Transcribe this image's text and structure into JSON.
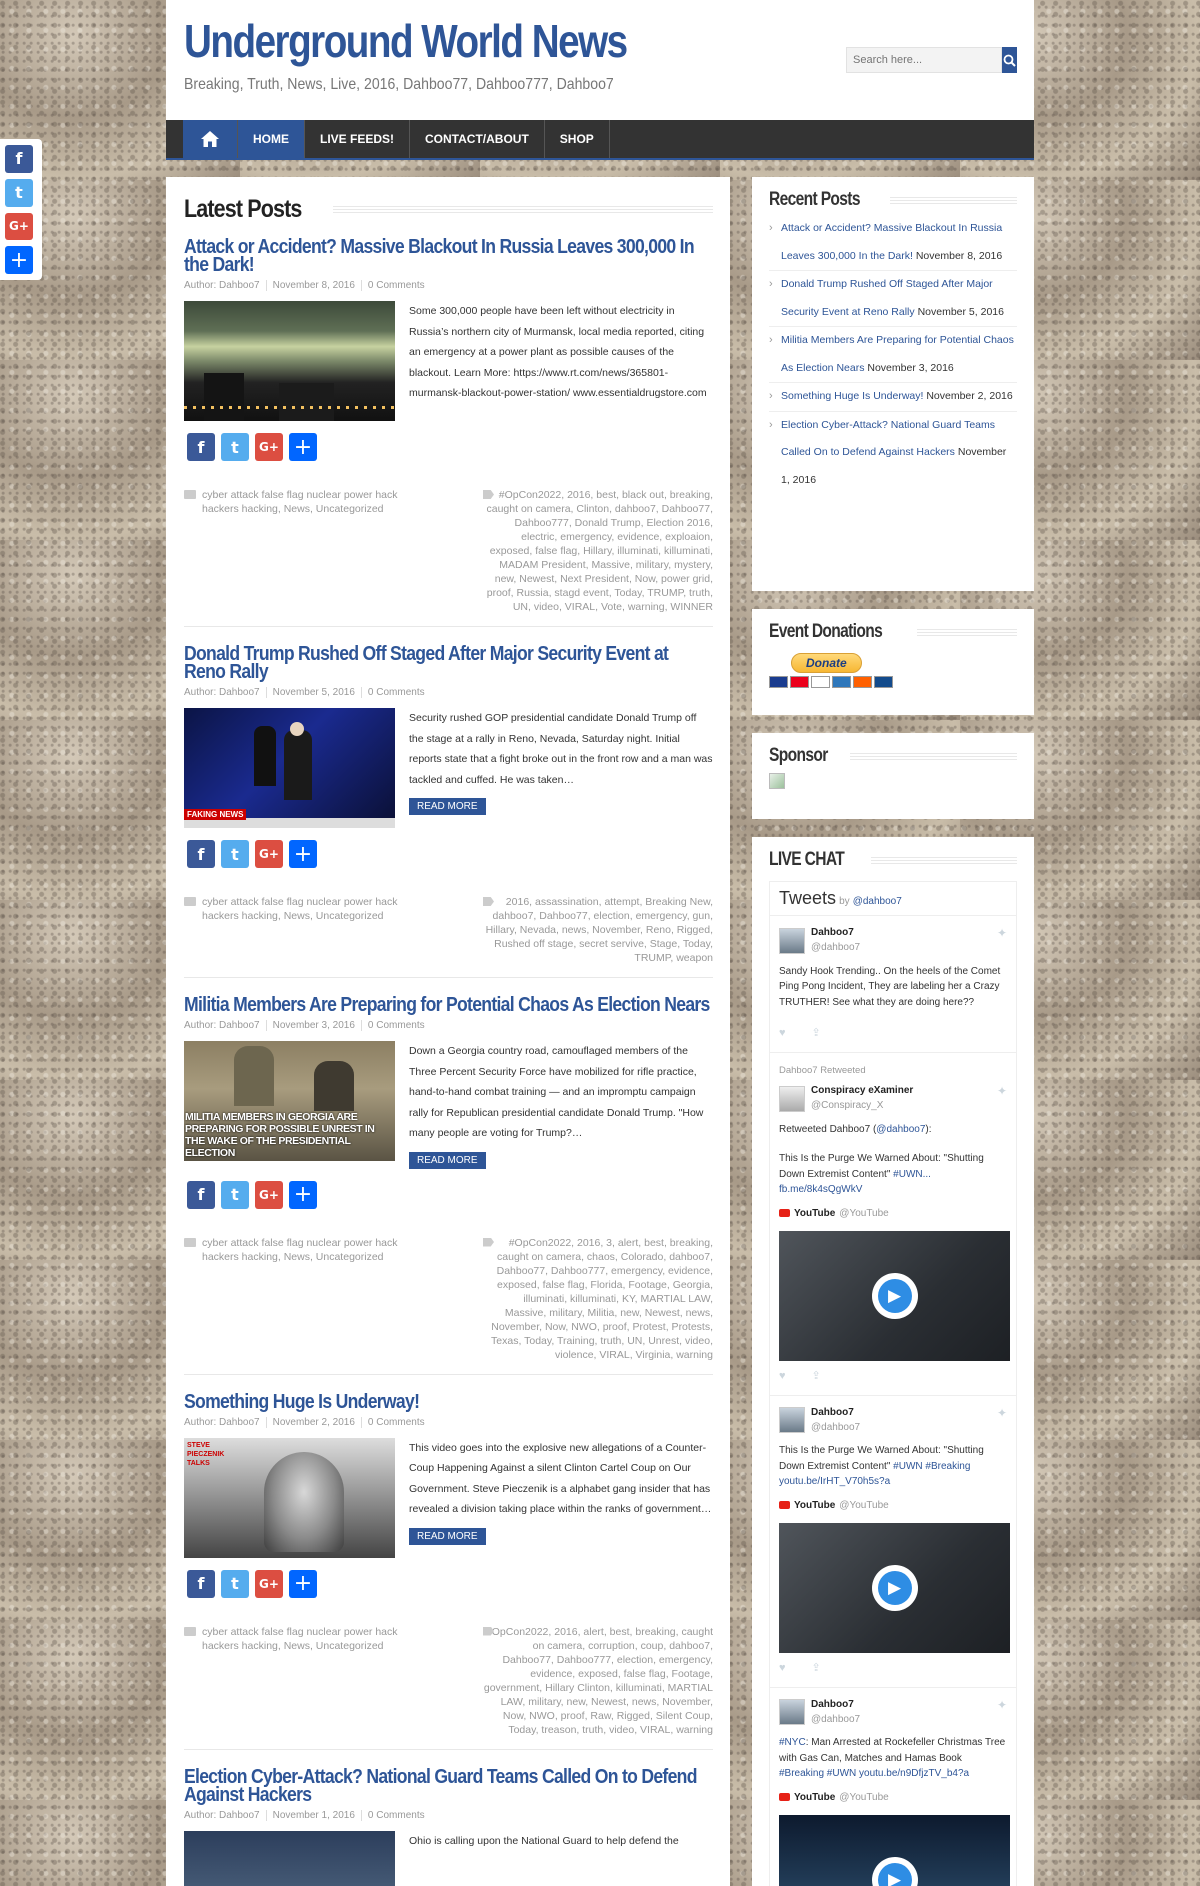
{
  "site": {
    "title": "Underground World News",
    "tagline": "Breaking, Truth, News, Live, 2016, Dahboo77, Dahboo777, Dahboo7"
  },
  "search": {
    "placeholder": "Search here..."
  },
  "nav": [
    "HOME",
    "LIVE FEEDS!",
    "CONTACT/ABOUT",
    "SHOP"
  ],
  "float_share": [
    "f",
    "t",
    "G+",
    "+"
  ],
  "main": {
    "section_title": "Latest Posts",
    "read_more": "READ MORE",
    "posts": [
      {
        "title": "Attack or Accident? Massive Blackout In Russia Leaves 300,000 In the Dark!",
        "author": "Author: Dahboo7",
        "date": "November 8, 2016",
        "comments": "0 Comments",
        "excerpt": "Some 300,000 people have been left without electricity in Russia’s northern city of Murmansk, local media reported, citing an emergency at a power plant as possible causes of the blackout.   Learn More: https://www.rt.com/news/365801-murmansk-blackout-power-station/ www.essentialdrugstore.com",
        "categories": "cyber attack false flag nuclear power hack hackers hacking, News, Uncategorized",
        "tags": "#OpCon2022, 2016, best, black out, breaking, caught on camera, Clinton, dahboo7, Dahboo77, Dahboo777, Donald Trump, Election 2016, electric, emergency, evidence, exploaion, exposed, false flag, Hillary, illuminati, killuminati, MADAM President, Massive, military, mystery, new, Newest, Next President, Now, power grid, proof, Russia, stagd event, Today, TRUMP, truth, UN, video, VIRAL, Vote, warning, WINNER"
      },
      {
        "title": "Donald Trump Rushed Off Staged After Major Security Event at Reno Rally",
        "author": "Author: Dahboo7",
        "date": "November 5, 2016",
        "comments": "0 Comments",
        "excerpt": "Security rushed GOP presidential candidate Donald Trump off the stage at a rally in Reno, Nevada, Saturday night. Initial reports state that a fight broke out in the front row and a man was tackled and cuffed. He was taken…",
        "thumb_caption": "FAKING NEWS",
        "categories": "cyber attack false flag nuclear power hack hackers hacking, News, Uncategorized",
        "tags": "2016, assassination, attempt, Breaking New, dahboo7, Dahboo77, election, emergency, gun, Hillary, Nevada, news, November, Reno, Rigged, Rushed off stage, secret servive, Stage, Today, TRUMP, weapon"
      },
      {
        "title": "Militia Members Are Preparing for Potential Chaos As Election Nears",
        "author": "Author: Dahboo7",
        "date": "November 3, 2016",
        "comments": "0 Comments",
        "excerpt": "Down a Georgia country road, camouflaged members of the Three Percent Security Force have mobilized for rifle practice, hand-to-hand combat training — and an impromptu campaign rally for Republican presidential candidate Donald Trump. \"How many people are voting for Trump?…",
        "thumb_caption": "MILITIA MEMBERS IN GEORGIA ARE PREPARING FOR POSSIBLE UNREST IN THE WAKE OF THE PRESIDENTIAL ELECTION",
        "categories": "cyber attack false flag nuclear power hack hackers hacking, News, Uncategorized",
        "tags": "#OpCon2022, 2016, 3, alert, best, breaking, caught on camera, chaos, Colorado, dahboo7, Dahboo77, Dahboo777, emergency, evidence, exposed, false flag, Florida, Footage, Georgia, illuminati, killuminati, KY, MARTIAL LAW, Massive, military, Militia, new, Newest, news, November, Now, NWO, proof, Protest, Protests, Texas, Today, Training, truth, UN, Unrest, video, violence, VIRAL, Virginia, warning"
      },
      {
        "title": "Something Huge Is Underway!",
        "author": "Author: Dahboo7",
        "date": "November 2, 2016",
        "comments": "0 Comments",
        "excerpt": "This video goes into the explosive new allegations of a Counter-Coup Happening Against a silent Clinton Cartel Coup on Our Government. Steve Pieczenik is a alphabet gang insider that has revealed a division taking place within the ranks of government…",
        "thumb_caption": "STEVE PIECZENIK TALKS",
        "categories": "cyber attack false flag nuclear power hack hackers hacking, News, Uncategorized",
        "tags": "#OpCon2022, 2016, alert, best, breaking, caught on camera, corruption, coup, dahboo7, Dahboo77, Dahboo777, election, emergency, evidence, exposed, false flag, Footage, government, Hillary Clinton, killuminati, MARTIAL LAW, military, new, Newest, news, November, Now, NWO, proof, Raw, Rigged, Silent Coup, Today, treason, truth, video, VIRAL, warning"
      },
      {
        "title": "Election Cyber-Attack? National Guard Teams Called On to Defend Against Hackers",
        "author": "Author: Dahboo7",
        "date": "November 1, 2016",
        "comments": "0 Comments",
        "excerpt": "Ohio is calling upon the National Guard to help defend the"
      }
    ]
  },
  "sidebar": {
    "recent_title": "Recent Posts",
    "recent": [
      {
        "link": "Attack or Accident? Massive Blackout In Russia Leaves 300,000 In the Dark!",
        "date": "November 8, 2016"
      },
      {
        "link": "Donald Trump Rushed Off Staged After Major Security Event at Reno Rally",
        "date": "November 5, 2016"
      },
      {
        "link": "Militia Members Are Preparing for Potential Chaos As Election Nears",
        "date": "November 3, 2016"
      },
      {
        "link": "Something Huge Is Underway!",
        "date": "November 2, 2016"
      },
      {
        "link": "Election Cyber-Attack? National Guard Teams Called On to Defend Against Hackers",
        "date": "November 1, 2016"
      }
    ],
    "donations_title": "Event Donations",
    "donate_label": "Donate",
    "sponsor_title": "Sponsor",
    "chat_title": "LIVE CHAT",
    "tweets_label": "Tweets",
    "tweets_by": "by",
    "tweets_handle": "@dahboo7",
    "tweets": [
      {
        "name": "Dahboo7",
        "handle": "@dahboo7",
        "text": "Sandy Hook Trending..  On the heels of the Comet Ping Pong Incident, They are labeling her a Crazy TRUTHER! See what they are doing here??"
      },
      {
        "retweet_label": "Dahboo7 Retweeted",
        "name": "Conspiracy eXaminer",
        "handle": "@Conspiracy_X",
        "text1": "Retweeted Dahboo7 (",
        "text1_link": "@dahboo7",
        "text1_end": "):",
        "text2": "This Is the Purge We Warned About: \"Shutting Down Extremist Content\"",
        "text2_link": "#UWN...",
        "text2_link2": "fb.me/8k4sQgWkV",
        "yt_name": "YouTube",
        "yt_handle": "@YouTube"
      },
      {
        "name": "Dahboo7",
        "handle": "@dahboo7",
        "text": "This Is the Purge We Warned About: \"Shutting Down Extremist Content\"",
        "links": "#UWN #Breaking",
        "link2": "youtu.be/IrHT_V70h5s?a",
        "yt_name": "YouTube",
        "yt_handle": "@YouTube"
      },
      {
        "name": "Dahboo7",
        "handle": "@dahboo7",
        "link_pre": "#NYC",
        "text": ": Man Arrested at Rockefeller Christmas Tree with Gas Can, Matches and Hamas Book",
        "links": "#Breaking #UWN youtu.be/n9DfjzTV_b4?a",
        "yt_name": "YouTube",
        "yt_handle": "@YouTube"
      }
    ]
  }
}
